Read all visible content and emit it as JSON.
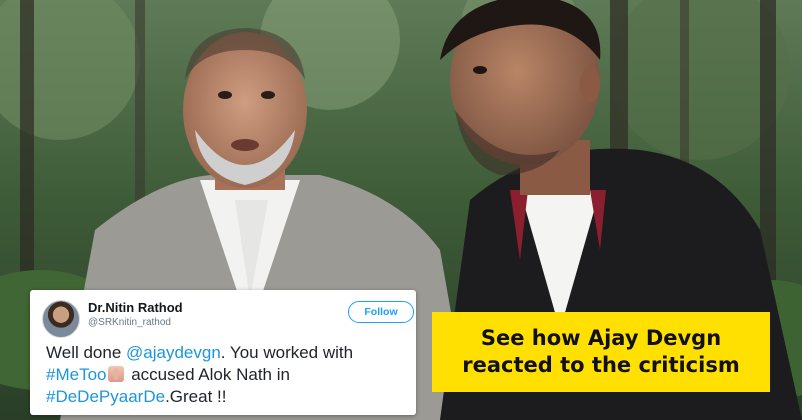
{
  "tweet": {
    "display_name": "Dr.Nitin Rathod",
    "handle": "@SRKnitin_rathod",
    "follow_label": "Follow",
    "line1_text": "Well done ",
    "mention": "@ajaydevgn",
    "line1_rest": ". You worked with",
    "hashtag_metoo": "#MeToo",
    "emoji_icon": "raised-hand-emoji-icon",
    "line2_rest": " accused Alok Nath in",
    "hashtag_movie": "#DeDePyaarDe",
    "line3_rest": ".Great !!"
  },
  "caption": {
    "line1": "See how Ajay Devgn",
    "line2": "reacted to the criticism"
  },
  "colors": {
    "caption_bg": "#ffe000",
    "link": "#1b95e0",
    "follow": "#1da1f2"
  }
}
